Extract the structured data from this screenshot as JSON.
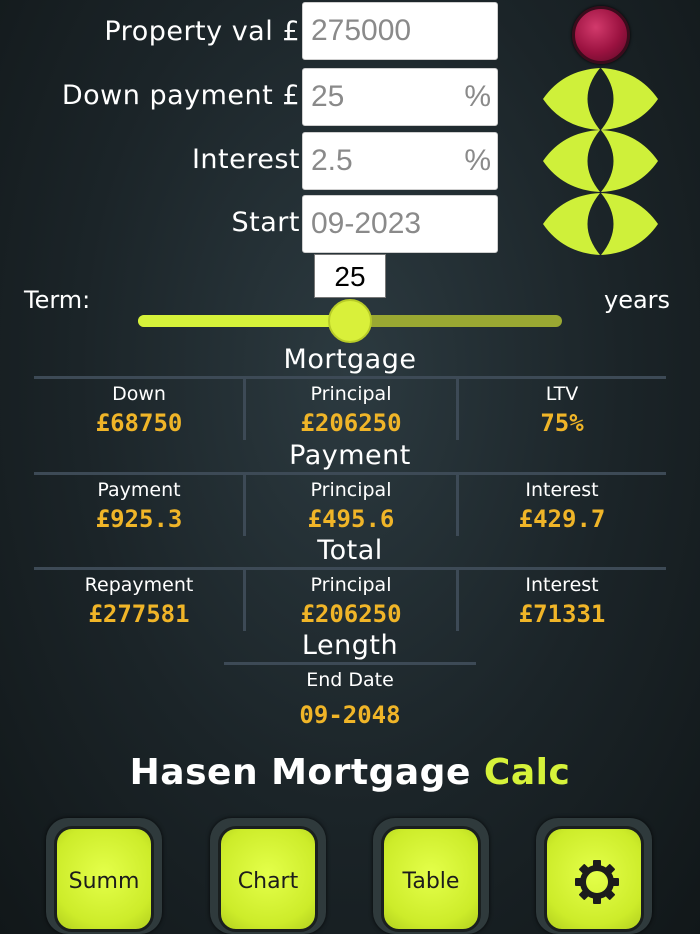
{
  "inputs": {
    "property": {
      "label": "Property val £",
      "value": "275000"
    },
    "down": {
      "label": "Down payment £",
      "value": "25",
      "unit": "%"
    },
    "interest": {
      "label": "Interest",
      "value": "2.5",
      "unit": "%"
    },
    "start": {
      "label": "Start",
      "value": "09-2023"
    }
  },
  "term": {
    "label": "Term:",
    "value": "25",
    "unit": "years",
    "fraction": 0.5
  },
  "mortgage": {
    "title": "Mortgage",
    "down": {
      "label": "Down",
      "value": "£68750"
    },
    "principal": {
      "label": "Principal",
      "value": "£206250"
    },
    "ltv": {
      "label": "LTV",
      "value": "75%"
    }
  },
  "payment": {
    "title": "Payment",
    "payment": {
      "label": "Payment",
      "value": "£925.3"
    },
    "principal": {
      "label": "Principal",
      "value": "£495.6"
    },
    "interest": {
      "label": "Interest",
      "value": "£429.7"
    }
  },
  "total": {
    "title": "Total",
    "repayment": {
      "label": "Repayment",
      "value": "£277581"
    },
    "principal": {
      "label": "Principal",
      "value": "£206250"
    },
    "interest": {
      "label": "Interest",
      "value": "£71331"
    }
  },
  "length": {
    "title": "Length",
    "end_date": {
      "label": "End Date",
      "value": "09-2048"
    }
  },
  "brand": {
    "main": "Hasen Mortgage",
    "accent": "Calc"
  },
  "nav": {
    "summ": "Summ",
    "chart": "Chart",
    "table": "Table",
    "settings_icon": "gear-icon"
  },
  "colors": {
    "accent": "#d6f23a",
    "value": "#f0b528",
    "record": "#9b1240"
  }
}
